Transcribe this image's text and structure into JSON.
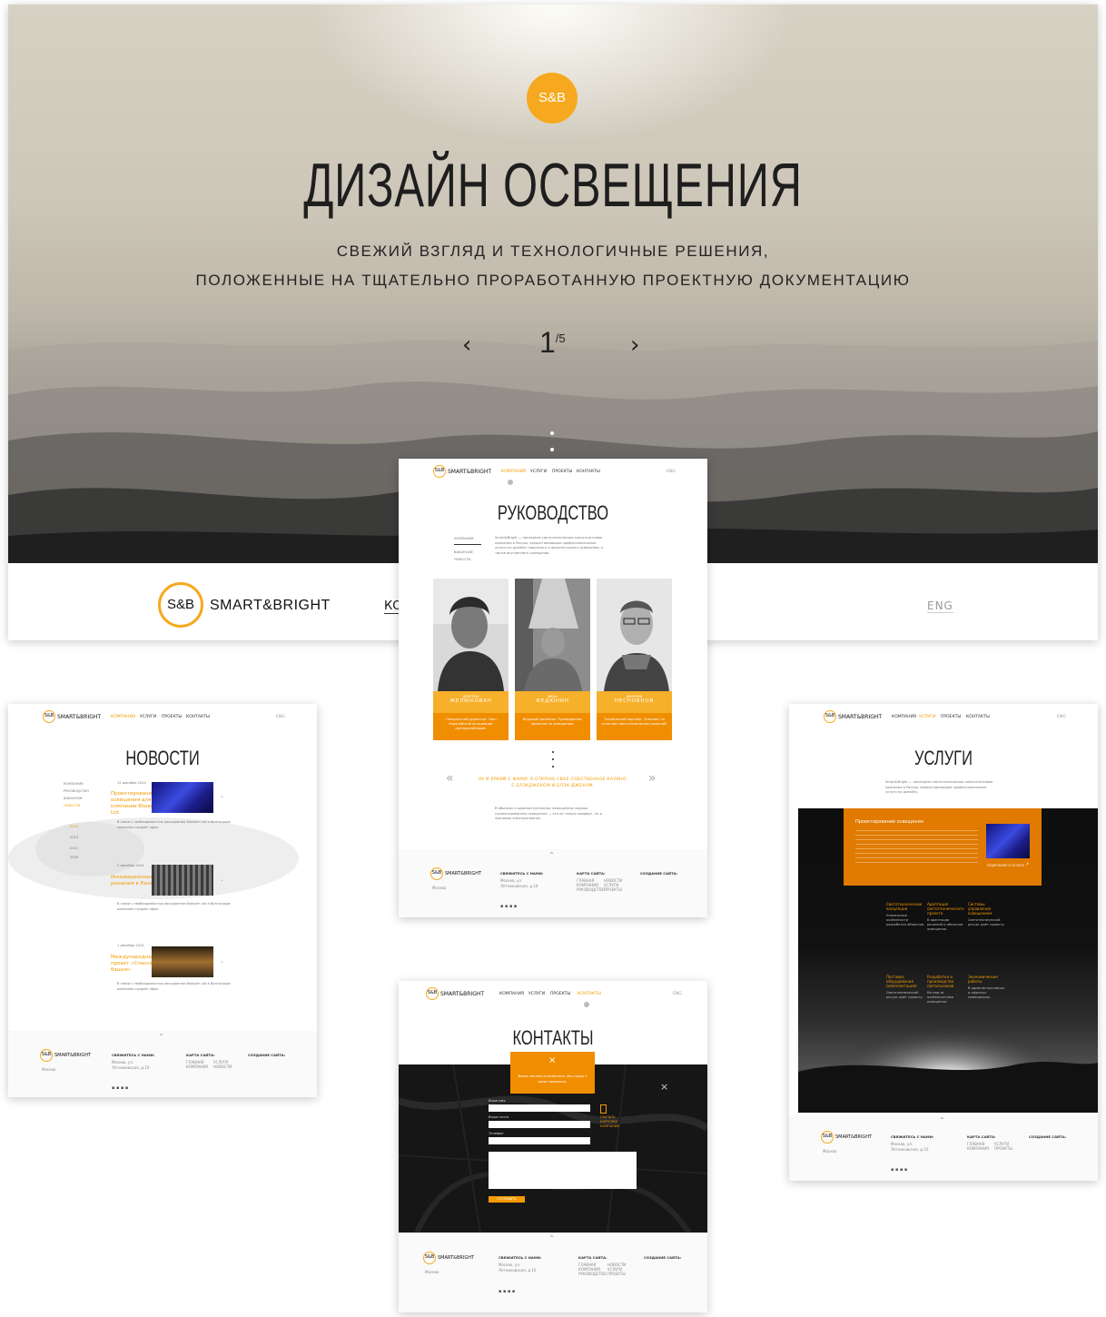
{
  "hero": {
    "logo": "S&B",
    "title": "ДИЗАЙН ОСВЕЩЕНИЯ",
    "subtitle_line1": "СВЕЖИЙ ВЗГЛЯД И ТЕХНОЛОГИЧНЫЕ РЕШЕНИЯ,",
    "subtitle_line2": "ПОЛОЖЕННЫЕ НА ТЩАТЕЛЬНО ПРОРАБОТАННУЮ ПРОЕКТНУЮ ДОКУМЕНТАЦИЮ",
    "slide_current": "1",
    "slide_total": "/5",
    "prev_arrow": "‹",
    "next_arrow": "›",
    "brand": "SMART&BRIGHT",
    "nav_first": "КО",
    "lang": "ENG"
  },
  "nav": {
    "brand": "SMART&BRIGHT",
    "logo": "S&B",
    "items": [
      "КОМПАНИЯ",
      "УСЛУГИ",
      "ПРОЕКТЫ",
      "КОНТАКТЫ"
    ],
    "lang": "ENG"
  },
  "leadership": {
    "title": "РУКОВОДСТВО",
    "side_menu": [
      "КОМПАНИЯ",
      "РУКОВОДСТВО",
      "ВАКАНСИИ",
      "НОВОСТИ"
    ],
    "intro": "Smart&Bright — последнее светотехническая консалтинговая компания в России, предоставляющая профессиональные услуги по дизайну наружного и архитектурного освещения, а также внутреннего освещения.",
    "people": [
      {
        "first": "ДМИТРИЙ",
        "last": "ЖЕЛЮКОВАН",
        "desc": "Генеральный директор. Член Европейской ассоциации светодизайнеров."
      },
      {
        "first": "ИВАН",
        "last": "ФЕДЮНИН",
        "desc": "Ведущий дизайнер. Руководитель проектов по освещению."
      },
      {
        "first": "ДМИТРИЙ",
        "last": "НЕСНОВНОВ",
        "desc": "Технический партнёр. Отвечает за качество светотехнических решений."
      }
    ],
    "quote_line1": "НУ И ЯРКИЙ С ФАМИ! Я ОТКРОЮ СВОЕ СОБСТВЕННОЕ КАЗИНО.",
    "quote_line2": "С БЛЭКДЖЕКОМ И БЛЭК-ДЖЕКОМ.",
    "body": "В обычных и административных помещениях хорошо спроектированное освещение — это не только комфорт, но и экономия электроэнергии."
  },
  "news": {
    "title": "НОВОСТИ",
    "side_menu": [
      "КОМПАНИЯ",
      "РУКОВОДСТВО",
      "ВАКАНСИИ",
      "НОВОСТИ"
    ],
    "years": [
      "2014",
      "2013",
      "2012",
      "2009"
    ],
    "items": [
      {
        "date": "12 декабря 2014",
        "title": "Проектирование освещения для компании Вlоiюsrh Ltd",
        "text": "В связи с необходимостью расширения Bioiswrh Ltd в Волгограде компания создаёт офис."
      },
      {
        "date": "5 декабря 2014",
        "title": "Инновационные решения в Казани",
        "text": "В связи с необходимостью расширения Bioiswrh Ltd в Волгограде компания создаёт офис."
      },
      {
        "date": "1 декабря 2014",
        "title": "Международный проект «Спасская башня»",
        "text": "В связи с необходимостью расширения Bioiswrh Ltd в Волгограде компания создаёт офис."
      }
    ]
  },
  "services": {
    "title": "УСЛУГИ",
    "intro": "Smart&Bright — последнее светотехническая консалтинговая компания в России, предоставляющая профессиональные услуги по дизайну.",
    "feature_title": "Проектирование освещения",
    "feature_more": "ПОДРОБНЕЕ О УСЛУГЕ",
    "items": [
      {
        "title": "Светотехнические концепции",
        "text": "Уникальные особенности разработки объектов."
      },
      {
        "title": "Адаптация светотехнического проекта",
        "text": "В адаптации решений и объектов освещения."
      },
      {
        "title": "Системы управления освещением",
        "text": "Светотехнический ресурс даёт проекту."
      },
      {
        "title": "Поставка оборудования (комплектация)",
        "text": "Светотехнический ресурс даёт проекту."
      },
      {
        "title": "Разработка и производство светильников",
        "text": "Взгляд за особенностями освещения."
      },
      {
        "title": "Экономические работы",
        "text": "В административных и офисных помещениях."
      }
    ]
  },
  "contacts": {
    "title": "КОНТАКТЫ",
    "popup_text": "Ваше письмо отправлено. Мы скоро с вами свяжемся.",
    "fields": [
      "Ваше имя",
      "Ваша почта",
      "Телефон"
    ],
    "download": "СКАЧАТЬ КАРТОЧКУ КОМПАНИИ",
    "submit": "ОТПРАВИТЬ"
  },
  "footer": {
    "contact_head": "СВЯЖИТЕСЬ С НАМИ:",
    "address": "Москва, ул. Летниковская, д.10",
    "sitemap_head": "КАРТА САЙТА:",
    "sitemap": [
      "ГЛАВНАЯ",
      "КОМПАНИЯ",
      "РУКОВОДСТВО",
      "ВАКАНСИИ",
      "НОВОСТИ",
      "УСЛУГИ",
      "ПРОЕКТЫ",
      "КОНТАКТЫ"
    ],
    "made_head": "СОЗДАНИЕ САЙТА:",
    "city": "Москва",
    "copyright": "© 2014"
  },
  "colors": {
    "accent": "#f39a00",
    "accent_light": "#f7b02a",
    "dark": "#111111"
  }
}
